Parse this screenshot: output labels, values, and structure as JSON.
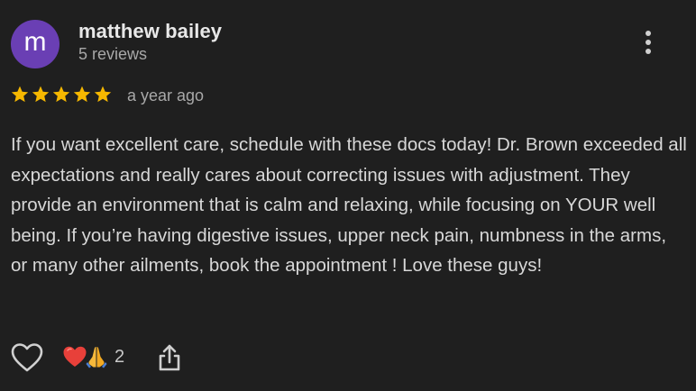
{
  "review": {
    "author": {
      "initial": "m",
      "name": "matthew bailey",
      "reviews_count": "5 reviews",
      "avatar_color": "#6a3fb4"
    },
    "rating": 5,
    "max_rating": 5,
    "star_color": "#f6b800",
    "time": "a year ago",
    "text": "If you want excellent care, schedule with these docs today! Dr. Brown exceeded all expectations and really cares about correcting issues with adjustment. They provide an environment that is calm and relaxing, while focusing on YOUR well being. If you’re having digestive issues, upper neck pain, numbness in the arms, or many other ailments, book the appointment ! Love these guys!",
    "reactions": {
      "emojis": [
        "heart-emoji",
        "praying-hands-emoji"
      ],
      "count": "2"
    },
    "icons": {
      "more": "more-vertical-icon",
      "like": "heart-outline-icon",
      "share": "share-icon"
    }
  }
}
